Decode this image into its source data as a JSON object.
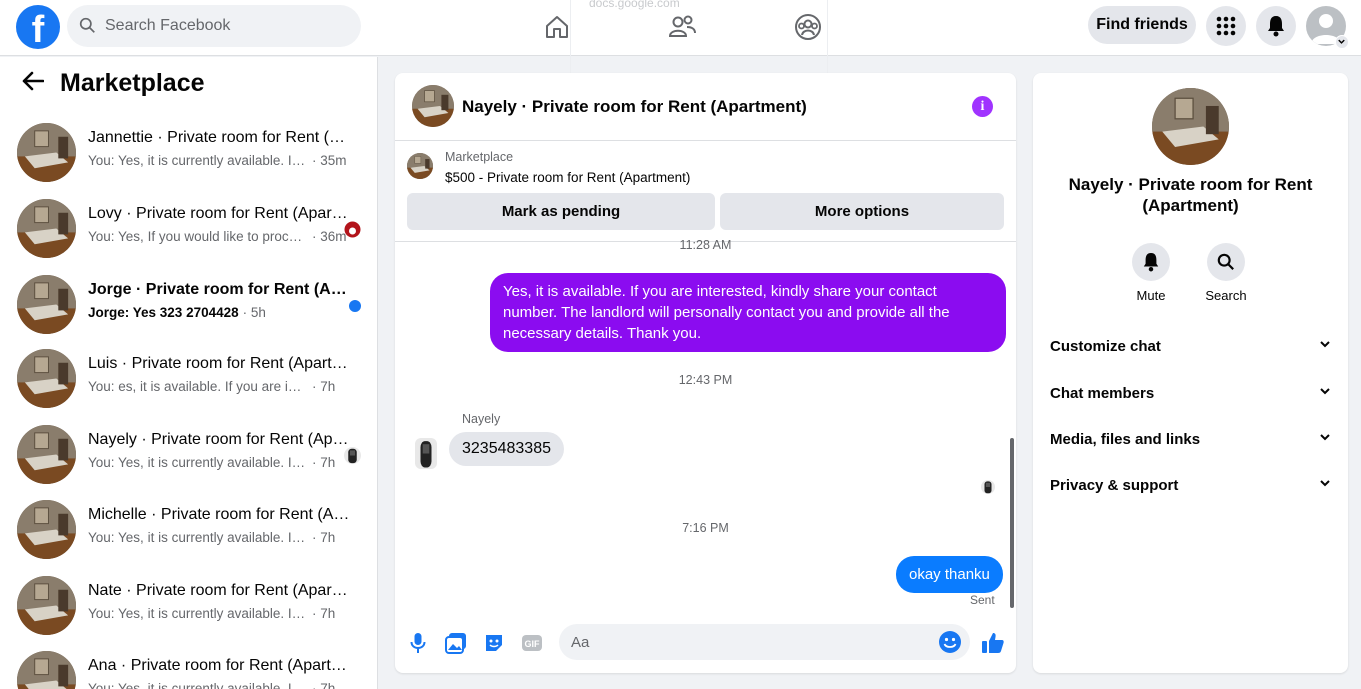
{
  "topbar": {
    "logo": "f",
    "search_placeholder": "Search Facebook",
    "ghost_url": "docs.google.com",
    "find_friends": "Find friends"
  },
  "sidebar": {
    "title": "Marketplace",
    "conversations": [
      {
        "name": "Jannettie · Private room for Rent (Apartment)",
        "preview": "You: Yes, it is currently available. If you",
        "time": "· 35m"
      },
      {
        "name": "Lovy · Private room for Rent (Apartment)",
        "preview": "You: Yes, If you would like to proceed",
        "time": "· 36m"
      },
      {
        "name": "Jorge · Private room for Rent (Apartment)",
        "preview": "Jorge: Yes 323 2704428",
        "time": "· 5h"
      },
      {
        "name": "Luis · Private room for Rent (Apartment)",
        "preview": "You: es, it is available. If you are interested",
        "time": "· 7h"
      },
      {
        "name": "Nayely · Private room for Rent (Apartment)",
        "preview": "You: Yes, it is currently available. If you",
        "time": "· 7h"
      },
      {
        "name": "Michelle · Private room for Rent (Apartment)",
        "preview": "You: Yes, it is currently available. If you",
        "time": "· 7h"
      },
      {
        "name": "Nate · Private room for Rent (Apartment)",
        "preview": "You: Yes, it is currently available. If you",
        "time": "· 7h"
      },
      {
        "name": "Ana · Private room for Rent (Apartment)",
        "preview": "You: Yes, it is currently available. If you",
        "time": "· 7h"
      }
    ]
  },
  "chat": {
    "title": "Nayely · Private room for Rent (Apartment)",
    "marketplace_label": "Marketplace",
    "item": "$500 - Private room for Rent (Apartment)",
    "mark_pending": "Mark as pending",
    "more_options": "More options",
    "ts1": "11:28 AM",
    "msg_out1": "Yes, it is available. If you are interested, kindly share your contact number. The landlord will personally contact you and provide all the necessary details. Thank you.",
    "ts2": "12:43 PM",
    "sender": "Nayely",
    "msg_in1": "3235483385",
    "ts3": "7:16 PM",
    "msg_out2": "okay thanku",
    "sent": "Sent",
    "composer_placeholder": "Aa",
    "gif": "GIF"
  },
  "info": {
    "title": "Nayely · Private room for Rent (Apartment)",
    "mute": "Mute",
    "search": "Search",
    "sections": [
      "Customize chat",
      "Chat members",
      "Media, files and links",
      "Privacy & support"
    ]
  },
  "colors": {
    "brand": "#1877f2",
    "outgoing_purple": "#8b0cf0",
    "outgoing_blue": "#0a7cff",
    "info_icon": "#a033ff"
  }
}
